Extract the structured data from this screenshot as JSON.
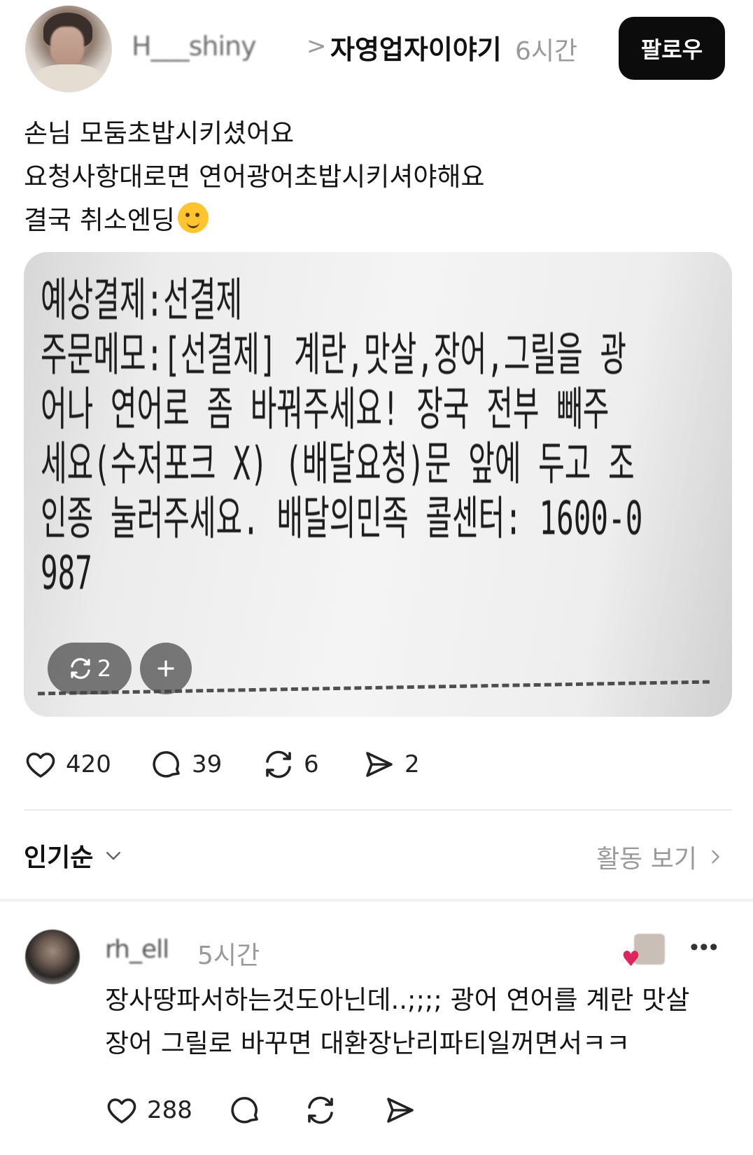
{
  "post": {
    "username": "H___shiny",
    "breadcrumb_separator": ">",
    "topic": "자영업자이야기",
    "time": "6시간",
    "follow_label": "팔로우",
    "text_lines": [
      "손님 모둠초밥시키셨어요",
      "요청사항대로면 연어광어초밥시키셔야해요",
      "결국 취소엔딩"
    ],
    "image": {
      "receipt_lines": [
        "예상결제:선결제",
        "주문메모:[선결제] 계란,맛살,장어,그릴을 광",
        "어나 연어로 좀 바꿔주세요! 장국 전부 빼주",
        "세요(수저포크 X) (배달요청)문 앞에 두고 조",
        "인종 눌러주세요. 배달의민족 콜센터: 1600-0",
        "987"
      ],
      "counter_value": "2",
      "counter_icon": "repost-icon",
      "add_icon": "plus-icon"
    },
    "stats": {
      "likes": "420",
      "comments": "39",
      "reposts": "6",
      "shares": "2"
    }
  },
  "replies_header": {
    "sort_label": "인기순",
    "activity_label": "활동 보기"
  },
  "comment": {
    "username": "rh_ell",
    "time": "5시간",
    "text_lines": [
      "장사땅파서하는것도아닌데..;;;; 광어 연어를 계란 맛살",
      "장어 그릴로 바꾸면 대환장난리파티일꺼면서ㅋㅋ"
    ],
    "more": "•••",
    "likes": "288"
  },
  "colors": {
    "follow_bg": "#0c0c0c",
    "muted_text": "#9a9a9a",
    "heart_red": "#e0245e"
  }
}
